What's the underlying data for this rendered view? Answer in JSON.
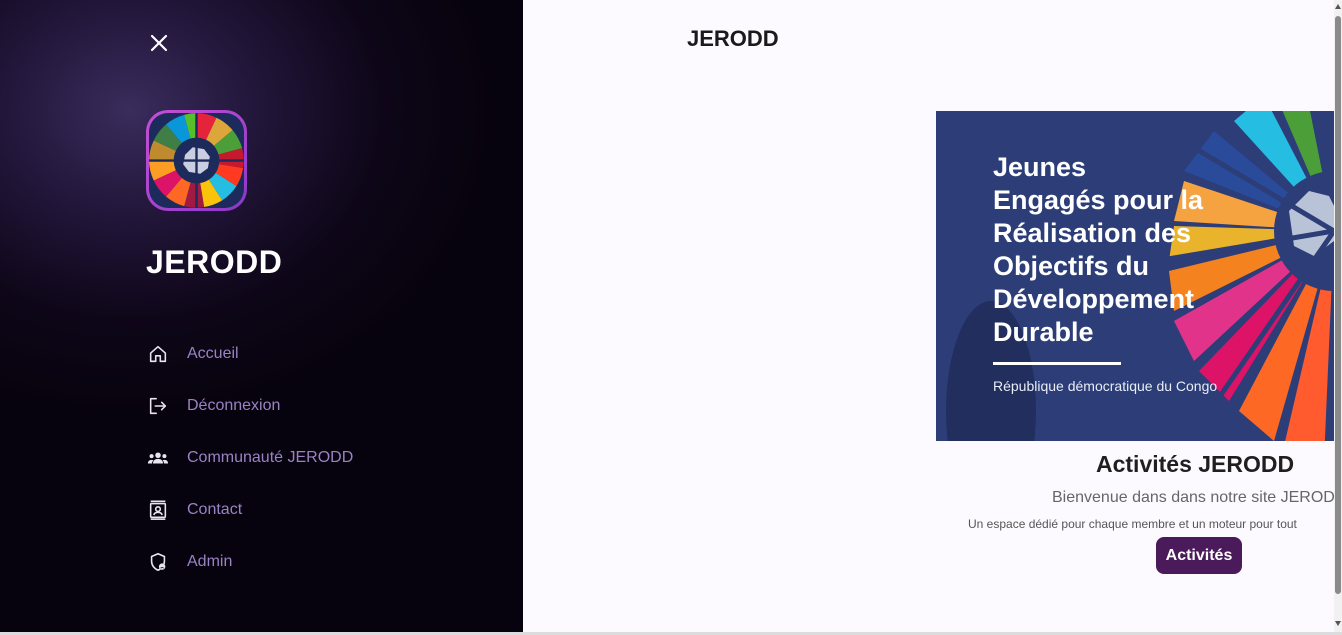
{
  "sidebar": {
    "brand": "JERODD",
    "items": [
      {
        "label": "Accueil",
        "icon": "home-icon"
      },
      {
        "label": "Déconnexion",
        "icon": "logout-icon"
      },
      {
        "label": "Communauté JERODD",
        "icon": "community-icon"
      },
      {
        "label": "Contact",
        "icon": "contact-icon"
      },
      {
        "label": "Admin",
        "icon": "admin-shield-icon"
      }
    ]
  },
  "main": {
    "title": "JERODD",
    "hero": {
      "line1": "Jeunes",
      "line2": "Engagés pour la",
      "line3": "Réalisation des",
      "line4": "Objectifs du",
      "line5": "Développement",
      "line6": "Durable",
      "subtitle": "République démocratique du Congo"
    },
    "activities_title": "Activités JERODD",
    "welcome": "Bienvenue dans dans notre site JEROD",
    "description": "Un espace dédié pour chaque membre et un moteur pour tout",
    "button_label": "Activités"
  },
  "colors": {
    "accent": "#4a1a5a",
    "nav_text": "#9a82c4",
    "hero_bg": "#2c3d78"
  }
}
